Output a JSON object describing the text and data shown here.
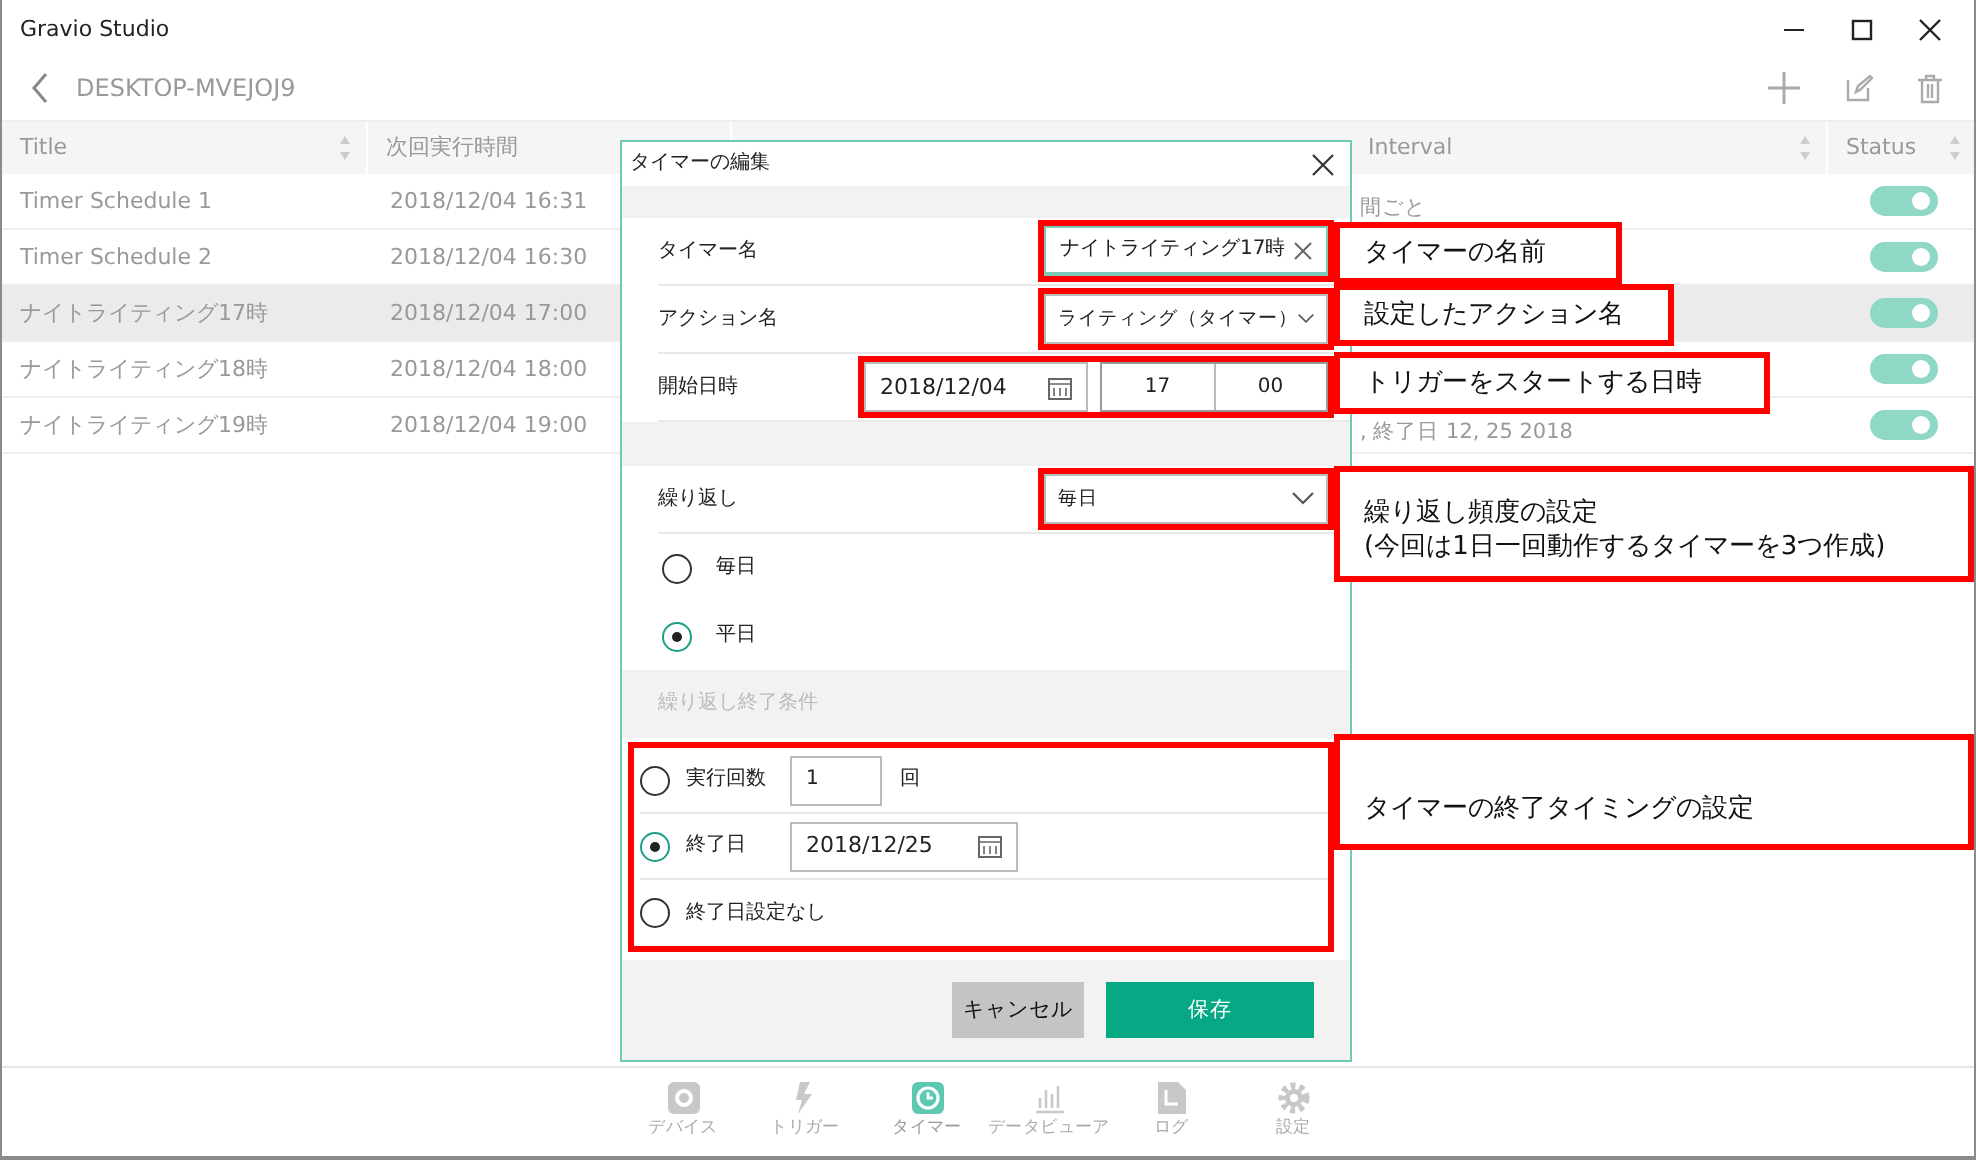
{
  "window": {
    "title": "Gravio Studio"
  },
  "header": {
    "device": "DESKTOP-MVEJOJ9"
  },
  "table": {
    "columns": [
      "Title",
      "次回実行時間",
      "Interval",
      "Status"
    ],
    "rows": [
      {
        "title": "Timer Schedule 1",
        "next_run": "2018/12/04 16:31",
        "interval": "間ごと",
        "status_on": true,
        "selected": false
      },
      {
        "title": "Timer Schedule 2",
        "next_run": "2018/12/04 16:30",
        "status_on": true,
        "selected": false
      },
      {
        "title": "ナイトライティング17時",
        "next_run": "2018/12/04 17:00",
        "status_on": true,
        "selected": true
      },
      {
        "title": "ナイトライティング18時",
        "next_run": "2018/12/04 18:00",
        "status_on": true,
        "selected": false
      },
      {
        "title": "ナイトライティング19時",
        "next_run": "2018/12/04 19:00",
        "interval": ", 終了日 12, 25 2018",
        "status_on": true,
        "selected": false
      }
    ]
  },
  "dialog": {
    "title": "タイマーの編集",
    "fields": [
      {
        "kind": "text",
        "label": "タイマー名",
        "value": "ナイトライティング17時"
      },
      {
        "kind": "select",
        "label": "アクション名",
        "value": "ライティング（タイマー）"
      },
      {
        "kind": "datetime",
        "label": "開始日時",
        "date": "2018/12/04",
        "hour": "17",
        "minute": "00"
      }
    ],
    "repeat": {
      "label": "繰り返し",
      "value": "毎日"
    },
    "repeat_options": [
      {
        "label": "毎日",
        "selected": false
      },
      {
        "label": "平日",
        "selected": true
      }
    ],
    "end_section": "繰り返し終了条件",
    "end_options": [
      {
        "kind": "count",
        "label": "実行回数",
        "value": "1",
        "unit": "回",
        "selected": false
      },
      {
        "kind": "date",
        "label": "終了日",
        "value": "2018/12/25",
        "selected": true
      },
      {
        "kind": "none",
        "label": "終了日設定なし",
        "selected": false
      }
    ],
    "buttons": [
      {
        "kind": "cancel",
        "label": "キャンセル"
      },
      {
        "kind": "save",
        "label": "保存"
      }
    ]
  },
  "nav": [
    {
      "label": "デバイス",
      "selected": false
    },
    {
      "label": "トリガー",
      "selected": false
    },
    {
      "label": "タイマー",
      "selected": true
    },
    {
      "label": "データビューア",
      "selected": false
    },
    {
      "label": "ログ",
      "selected": false
    },
    {
      "label": "設定",
      "selected": false
    }
  ],
  "callouts": [
    {
      "lines": [
        "タイマーの名前"
      ]
    },
    {
      "lines": [
        "設定したアクション名"
      ]
    },
    {
      "lines": [
        "トリガーをスタートする日時"
      ]
    },
    {
      "lines": [
        "繰り返し頻度の設定",
        "(今回は1日一回動作するタイマーを3つ作成)"
      ]
    },
    {
      "lines": [
        "タイマーの終了タイミングの設定"
      ]
    }
  ]
}
